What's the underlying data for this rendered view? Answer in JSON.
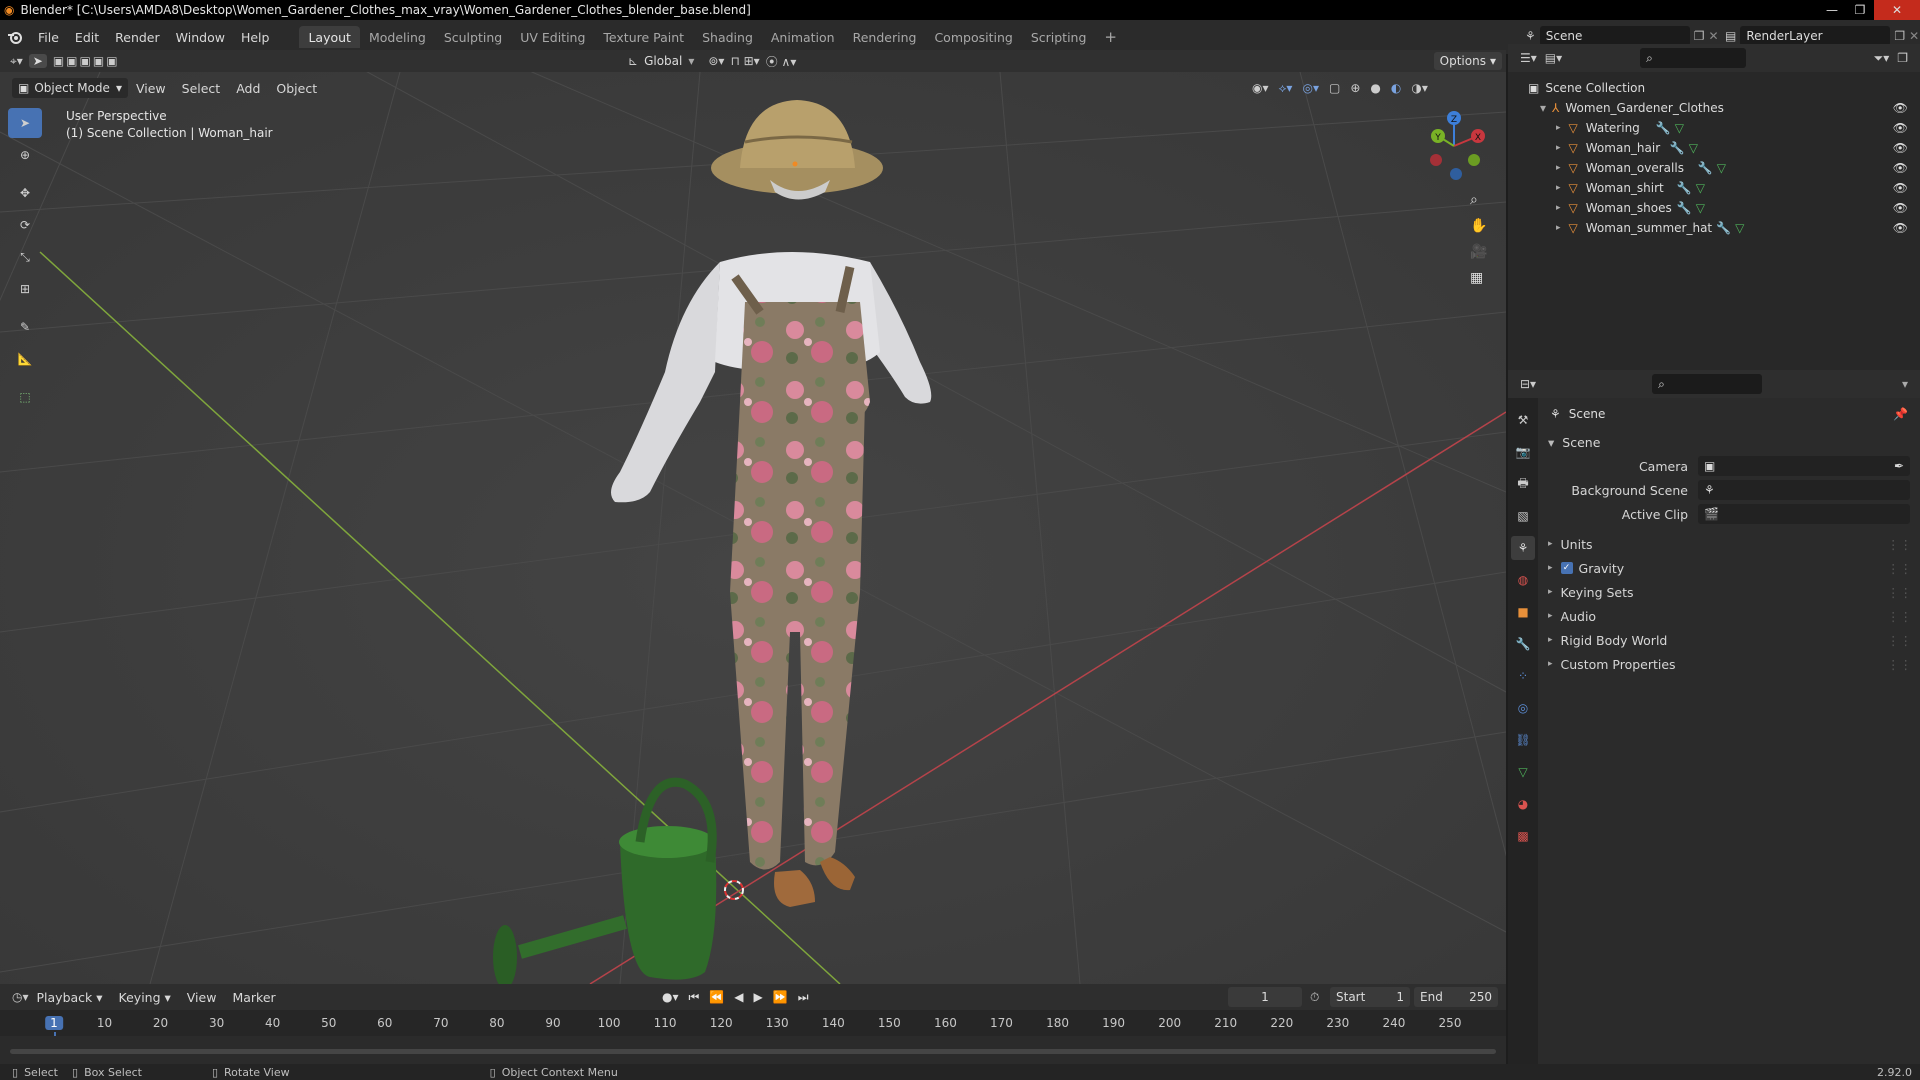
{
  "titlebar": {
    "title": "Blender* [C:\\Users\\AMDA8\\Desktop\\Women_Gardener_Clothes_max_vray\\Women_Gardener_Clothes_blender_base.blend]"
  },
  "menu": [
    "File",
    "Edit",
    "Render",
    "Window",
    "Help"
  ],
  "workspaces": [
    "Layout",
    "Modeling",
    "Sculpting",
    "UV Editing",
    "Texture Paint",
    "Shading",
    "Animation",
    "Rendering",
    "Compositing",
    "Scripting"
  ],
  "active_workspace": "Layout",
  "scene_field": "Scene",
  "renderlayer_field": "RenderLayer",
  "viewport": {
    "mode": "Object Mode",
    "menus": [
      "View",
      "Select",
      "Add",
      "Object"
    ],
    "orientation": "Global",
    "options_label": "Options",
    "info_line1": "User Perspective",
    "info_line2": "(1) Scene Collection | Woman_hair",
    "gizmo_axes": {
      "x": "X",
      "y": "Y",
      "z": "Z"
    }
  },
  "outliner": {
    "root": "Scene Collection",
    "collection": "Women_Gardener_Clothes",
    "objects": [
      "Watering",
      "Woman_hair",
      "Woman_overalls",
      "Woman_shirt",
      "Woman_shoes",
      "Woman_summer_hat"
    ]
  },
  "properties": {
    "context": "Scene",
    "panel": "Scene",
    "camera_label": "Camera",
    "background_scene_label": "Background Scene",
    "active_clip_label": "Active Clip",
    "subpanels": [
      "Units",
      "Gravity",
      "Keying Sets",
      "Audio",
      "Rigid Body World",
      "Custom Properties"
    ],
    "gravity_checked": true
  },
  "timeline": {
    "menus": [
      "Playback",
      "Keying",
      "View",
      "Marker"
    ],
    "current_frame": "1",
    "start_label": "Start",
    "start": "1",
    "end_label": "End",
    "end": "250",
    "ruler": [
      "1",
      "10",
      "20",
      "30",
      "40",
      "50",
      "60",
      "70",
      "80",
      "90",
      "100",
      "110",
      "120",
      "130",
      "140",
      "150",
      "160",
      "170",
      "180",
      "190",
      "200",
      "210",
      "220",
      "230",
      "240",
      "250"
    ]
  },
  "statusbar": {
    "select": "Select",
    "box_select": "Box Select",
    "rotate_view": "Rotate View",
    "context_menu": "Object Context Menu",
    "version": "2.92.0"
  },
  "colors": {
    "accent": "#4772b3",
    "x_axis": "#c8373e",
    "y_axis": "#79b226",
    "z_axis": "#3d7fd9",
    "object_icon": "#e8903a"
  }
}
